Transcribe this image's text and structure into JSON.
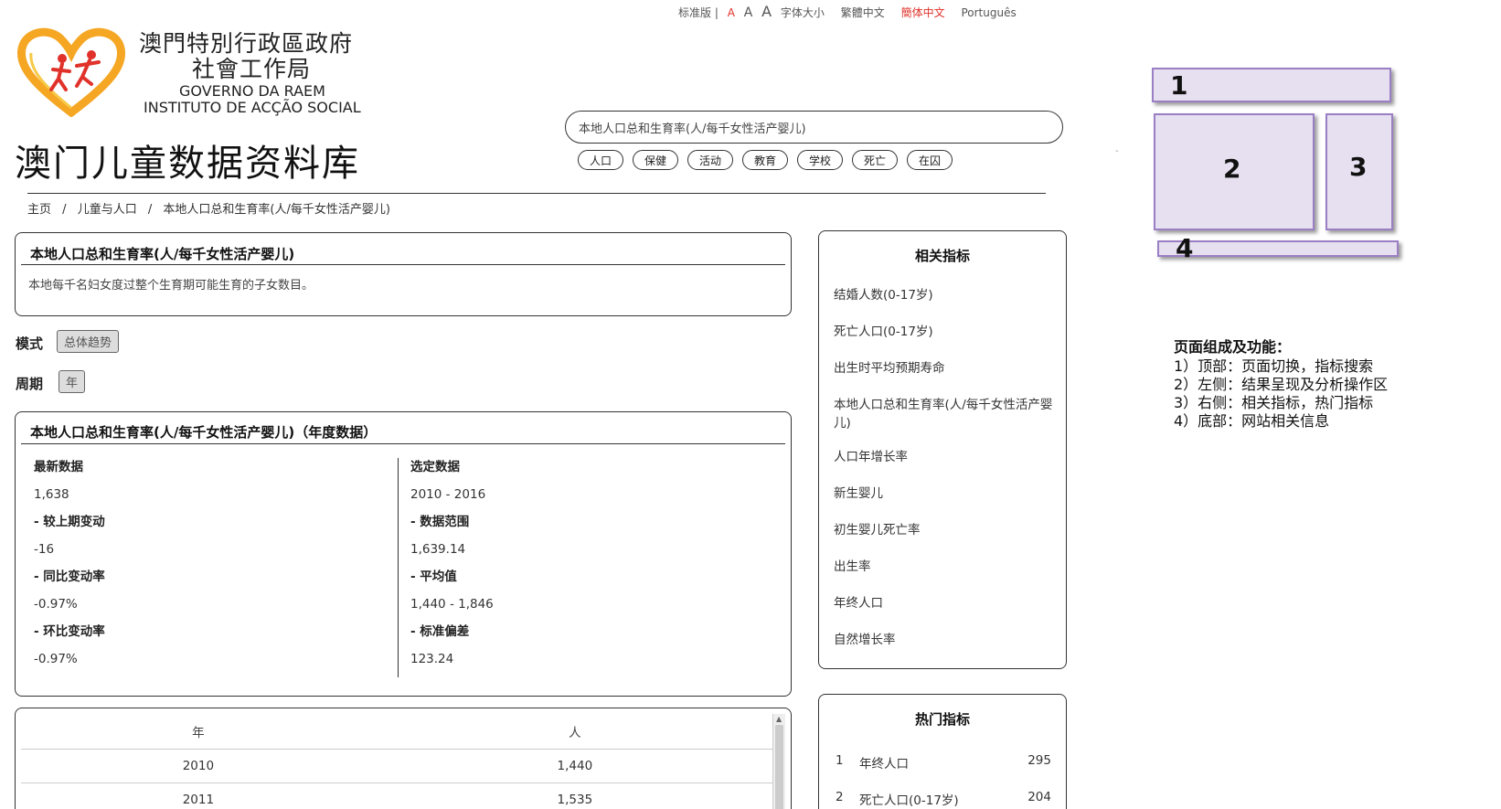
{
  "top_links": {
    "standard": "标准版 |",
    "font_a_small": "A",
    "font_a_medium": "A",
    "font_a_large": "A",
    "font_size_label": "字体大小",
    "traditional": "繁體中文",
    "simplified": "簡体中文",
    "portuguese": "Português"
  },
  "org": {
    "cn_line1": "澳門特別行政區政府",
    "cn_line2": "社會工作局",
    "pt_line1": "GOVERNO DA RAEM",
    "pt_line2": "INSTITUTO DE ACÇÃO SOCIAL"
  },
  "site_title": "澳门儿童数据资料库",
  "search": {
    "value": "本地人口总和生育率(人/每千女性活产婴儿)"
  },
  "categories": [
    "人口",
    "保健",
    "活动",
    "教育",
    "学校",
    "死亡",
    "在囚"
  ],
  "breadcrumb": [
    "主页",
    "/",
    "儿童与人口",
    "/",
    "本地人口总和生育率(人/每千女性活产婴儿)"
  ],
  "indicator": {
    "title": "本地人口总和生育率(人/每千女性活产婴儿)",
    "description": "本地每千名妇女度过整个生育期可能生育的子女数目。"
  },
  "mode": {
    "label": "模式",
    "value": "总体趋势"
  },
  "period": {
    "label": "周期",
    "value": "年"
  },
  "stats": {
    "title": "本地人口总和生育率(人/每千女性活产婴儿)（年度数据）",
    "left": [
      {
        "label": "最新数据",
        "value": "1,638"
      },
      {
        "label": "- 较上期变动",
        "value": "-16"
      },
      {
        "label": "- 同比变动率",
        "value": "-0.97%"
      },
      {
        "label": "- 环比变动率",
        "value": "-0.97%"
      }
    ],
    "right": [
      {
        "label": "选定数据",
        "value": "2010 - 2016"
      },
      {
        "label": "- 数据范围",
        "value": "1,639.14"
      },
      {
        "label": "- 平均值",
        "value": "1,440 - 1,846"
      },
      {
        "label": "- 标准偏差",
        "value": "123.24"
      }
    ]
  },
  "table": {
    "headers": [
      "年",
      "人"
    ],
    "rows": [
      [
        "2010",
        "1,440"
      ],
      [
        "2011",
        "1,535"
      ]
    ]
  },
  "related": {
    "title": "相关指标",
    "items": [
      "结婚人数(0-17岁)",
      "死亡人口(0-17岁)",
      "出生时平均预期寿命",
      "本地人口总和生育率(人/每千女性活产婴儿)",
      "人口年增长率",
      "新生婴儿",
      "初生婴儿死亡率",
      "出生率",
      "年终人口",
      "自然增长率"
    ]
  },
  "hot": {
    "title": "热门指标",
    "items": [
      {
        "rank": "1",
        "name": "年终人口",
        "count": "295"
      },
      {
        "rank": "2",
        "name": "死亡人口(0-17岁)",
        "count": "204"
      }
    ]
  },
  "diagram": {
    "labels": [
      "1",
      "2",
      "3",
      "4"
    ],
    "dash": "-",
    "legend_title": "页面组成及功能：",
    "legend_items": [
      "1）顶部：页面切换，指标搜索",
      "2）左侧：结果呈现及分析操作区",
      "3）右侧：相关指标，热门指标",
      "4）底部：网站相关信息"
    ]
  }
}
